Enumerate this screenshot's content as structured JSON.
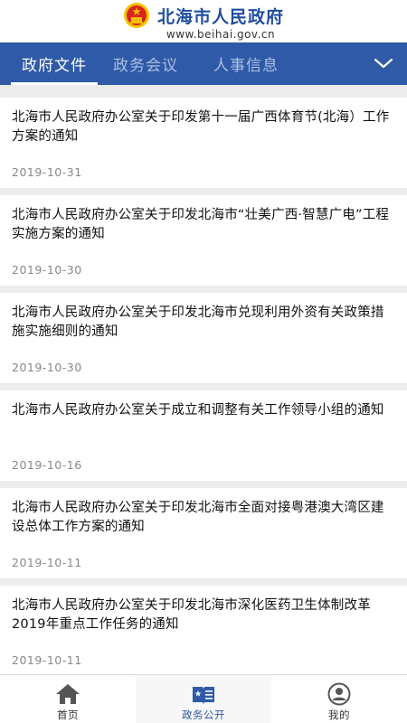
{
  "header": {
    "title": "北海市人民政府",
    "url": "www.beihai.gov.cn",
    "emblem_icon": "national-emblem-icon"
  },
  "tabs": [
    {
      "label": "政府文件",
      "active": true
    },
    {
      "label": "政务会议",
      "active": false
    },
    {
      "label": "人事信息",
      "active": false
    }
  ],
  "tabs_toggle_icon": "chevron-down-icon",
  "list": [
    {
      "title": "北海市人民政府办公室关于印发第十一届广西体育节(北海）工作方案的通知",
      "date": "2019-10-31"
    },
    {
      "title": "北海市人民政府办公室关于印发北海市“壮美广西·智慧广电”工程实施方案的通知",
      "date": "2019-10-30"
    },
    {
      "title": "北海市人民政府办公室关于印发北海市兑现利用外资有关政策措施实施细则的通知",
      "date": "2019-10-30"
    },
    {
      "title": "北海市人民政府办公室关于成立和调整有关工作领导小组的通知",
      "date": "2019-10-16"
    },
    {
      "title": "北海市人民政府办公室关于印发北海市全面对接粤港澳大湾区建设总体工作方案的通知",
      "date": "2019-10-11"
    },
    {
      "title": "北海市人民政府办公室关于印发北海市深化医药卫生体制改革2019年重点工作任务的通知",
      "date": "2019-10-11"
    }
  ],
  "bottom_nav": [
    {
      "label": "首页",
      "icon": "home-icon",
      "active": false
    },
    {
      "label": "政务公开",
      "icon": "book-icon",
      "active": true
    },
    {
      "label": "我的",
      "icon": "user-icon",
      "active": false
    }
  ],
  "colors": {
    "brand_blue": "#2e5aa7",
    "title_blue": "#1f4ea1",
    "emblem_red": "#d9251d",
    "emblem_gold": "#f2c200"
  }
}
